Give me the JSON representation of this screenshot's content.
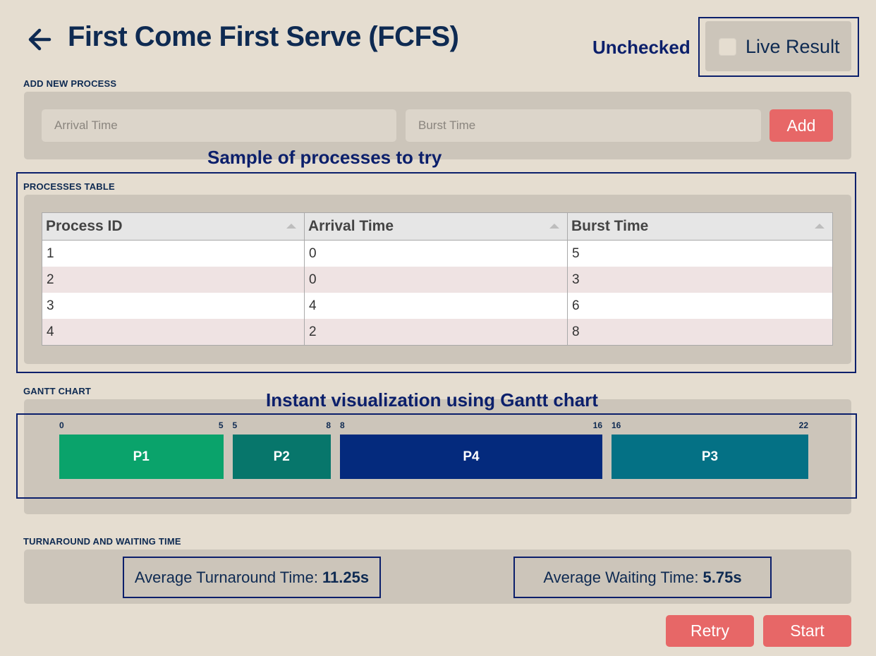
{
  "header": {
    "title": "First Come First Serve (FCFS)"
  },
  "live_result": {
    "label": "Live Result",
    "checked": false
  },
  "annotations": {
    "unchecked": "Unchecked",
    "sample": "Sample of processes to try",
    "gantt": "Instant visualization using Gantt chart"
  },
  "add_process": {
    "section_label": "ADD NEW PROCESS",
    "arrival_placeholder": "Arrival Time",
    "burst_placeholder": "Burst Time",
    "add_label": "Add"
  },
  "processes_table": {
    "section_label": "PROCESSES TABLE",
    "headers": [
      "Process ID",
      "Arrival Time",
      "Burst Time"
    ],
    "rows": [
      [
        "1",
        "0",
        "5"
      ],
      [
        "2",
        "0",
        "3"
      ],
      [
        "3",
        "4",
        "6"
      ],
      [
        "4",
        "2",
        "8"
      ]
    ]
  },
  "gantt": {
    "section_label": "GANTT CHART",
    "segments": [
      {
        "label": "P1",
        "start": 0,
        "end": 5,
        "start_label": "0",
        "end_label": "5",
        "color": "#0aa36b"
      },
      {
        "label": "P2",
        "start": 5,
        "end": 8,
        "start_label": "5",
        "end_label": "8",
        "color": "#07766b"
      },
      {
        "label": "P4",
        "start": 8,
        "end": 16,
        "start_label": "8",
        "end_label": "16",
        "color": "#042a7d"
      },
      {
        "label": "P3",
        "start": 16,
        "end": 22,
        "start_label": "16",
        "end_label": "22",
        "color": "#047185"
      }
    ]
  },
  "metrics": {
    "section_label": "TURNAROUND AND WAITING TIME",
    "turnaround_label": "Average Turnaround Time:",
    "turnaround_value": "11.25s",
    "waiting_label": "Average Waiting Time:",
    "waiting_value": "5.75s"
  },
  "footer": {
    "retry_label": "Retry",
    "start_label": "Start"
  },
  "colors": {
    "background": "#e5ddd0",
    "panel": "#ccc5ba",
    "accent": "#e76767",
    "annotation": "#0b1f6b"
  }
}
